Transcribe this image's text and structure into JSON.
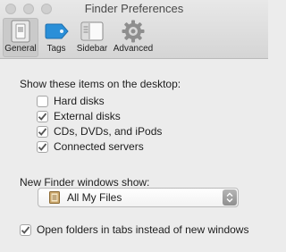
{
  "window": {
    "title": "Finder Preferences"
  },
  "toolbar": {
    "items": [
      {
        "label": "General",
        "icon": "general-switch-icon",
        "selected": true
      },
      {
        "label": "Tags",
        "icon": "tag-icon",
        "selected": false
      },
      {
        "label": "Sidebar",
        "icon": "sidebar-icon",
        "selected": false
      },
      {
        "label": "Advanced",
        "icon": "gear-icon",
        "selected": false
      }
    ]
  },
  "desktop": {
    "heading": "Show these items on the desktop:",
    "items": [
      {
        "label": "Hard disks",
        "checked": false
      },
      {
        "label": "External disks",
        "checked": true
      },
      {
        "label": "CDs, DVDs, and iPods",
        "checked": true
      },
      {
        "label": "Connected servers",
        "checked": true
      }
    ]
  },
  "new_window": {
    "label": "New Finder windows show:",
    "selected": "All My Files",
    "icon": "all-files-icon"
  },
  "tabs_option": {
    "label": "Open folders in tabs instead of new windows",
    "checked": true
  },
  "colors": {
    "selected_tab_bg": "#cacaca",
    "tag_blue": "#2a8fd8"
  }
}
